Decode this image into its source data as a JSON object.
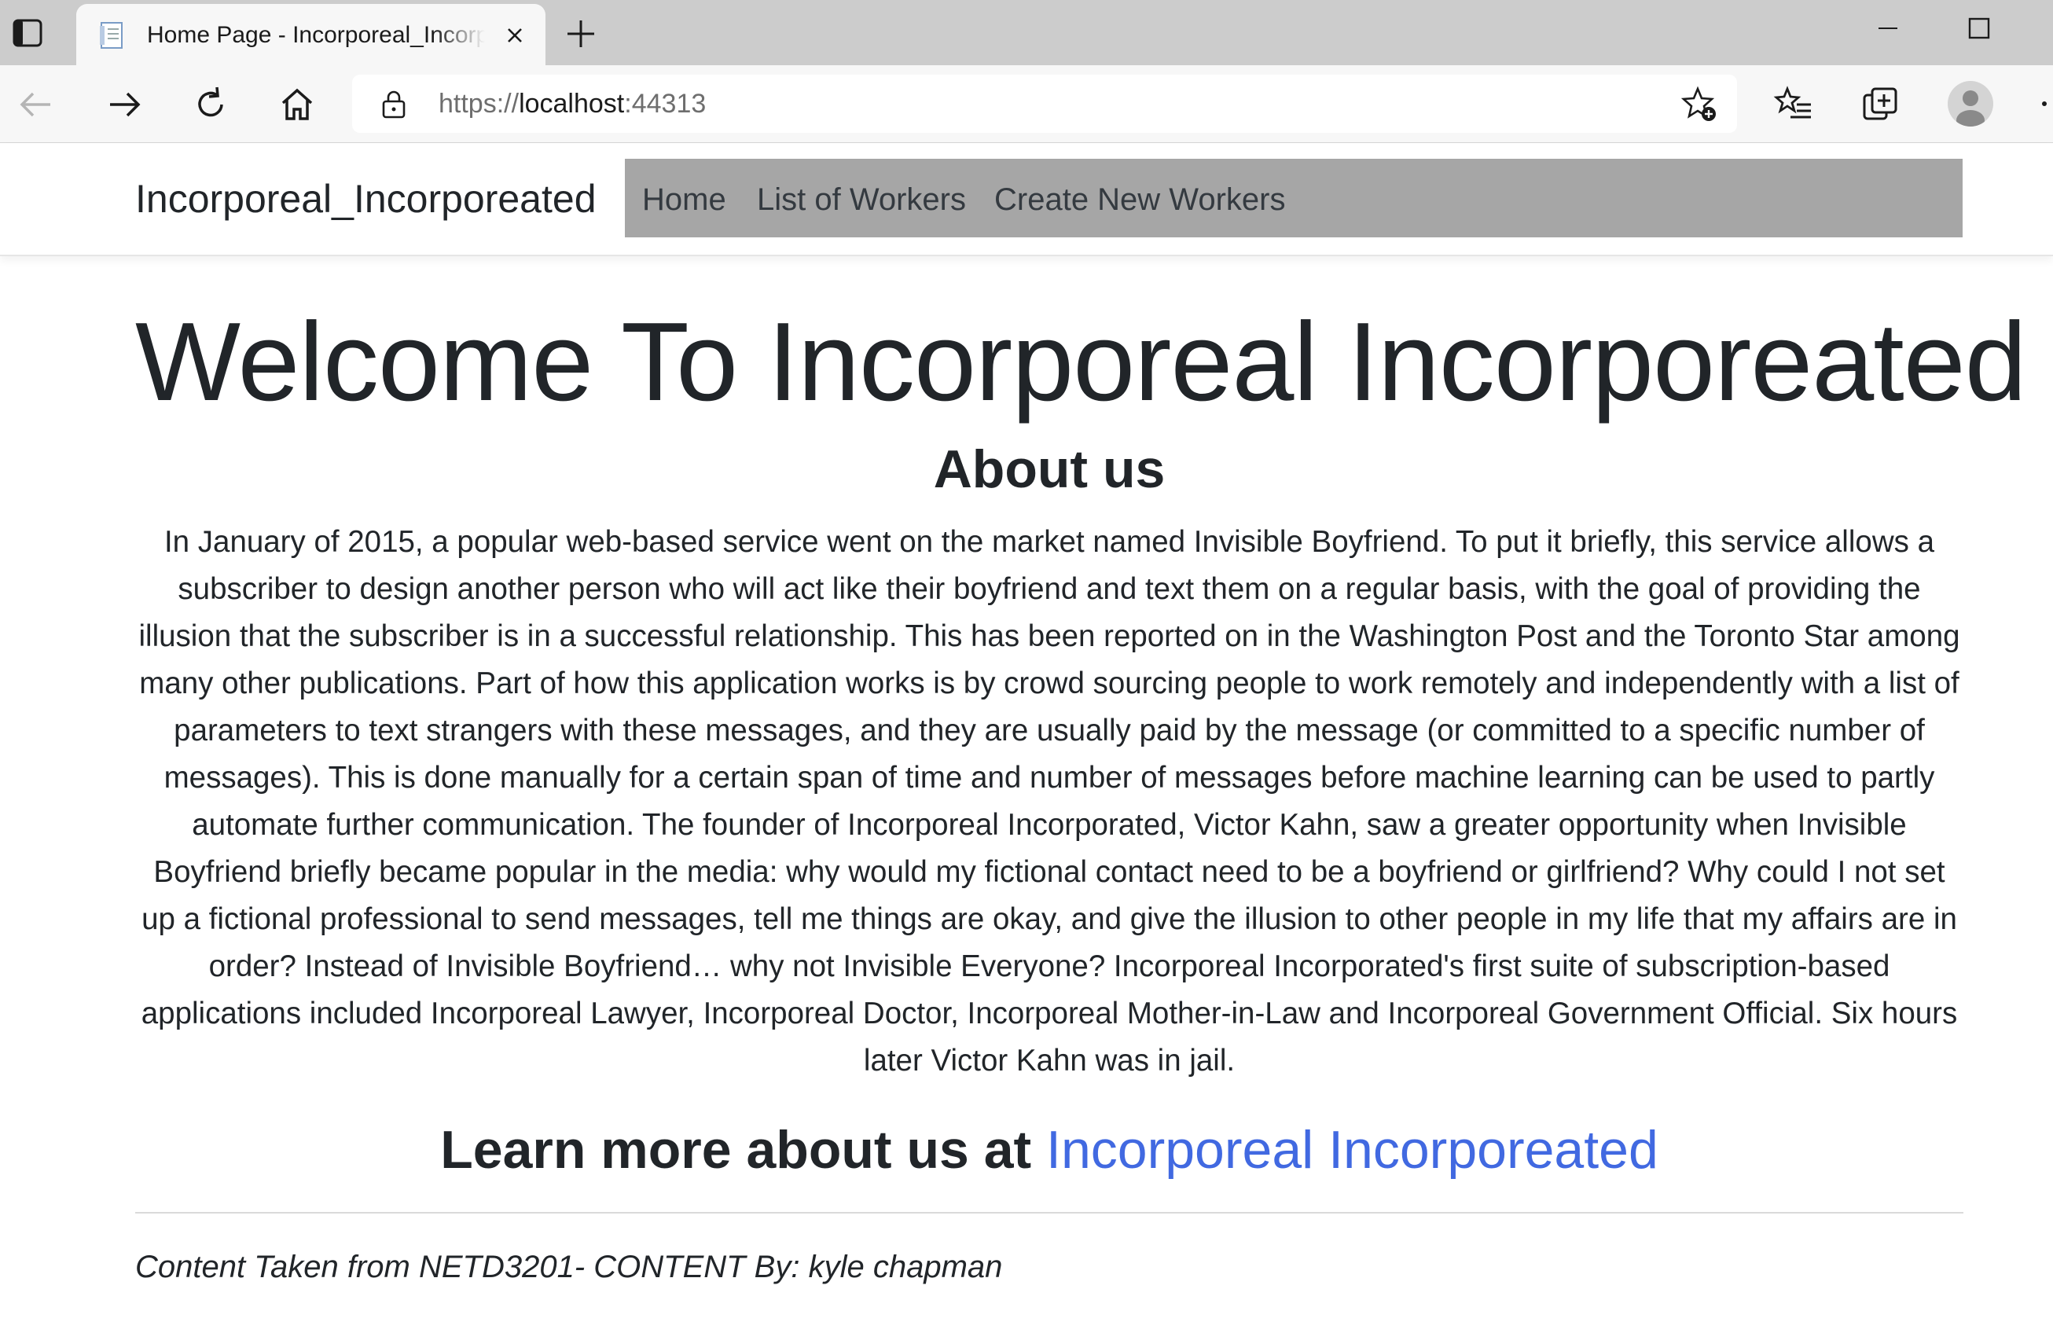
{
  "browser": {
    "tab_title": "Home Page - Incorporeal_Incorporeated",
    "url": {
      "scheme": "https://",
      "host": "localhost",
      "port": ":44313"
    }
  },
  "site": {
    "brand": "Incorporeal_Incorporeated",
    "nav": {
      "home": "Home",
      "list_workers": "List of Workers",
      "create_workers": "Create New Workers"
    },
    "nav_bg_color": "#a6a6a6"
  },
  "main": {
    "heading": "Welcome To Incorporeal Incorporeated",
    "about_title": "About us",
    "about_text": "In January of 2015, a popular web-based service went on the market named Invisible Boyfriend. To put it briefly, this service allows a subscriber to design another person who will act like their boyfriend and text them on a regular basis, with the goal of providing the illusion that the subscriber is in a successful relationship. This has been reported on in the Washington Post and the Toronto Star among many other publications. Part of how this application works is by crowd sourcing people to work remotely and independently with a list of parameters to text strangers with these messages, and they are usually paid by the message (or committed to a specific number of messages). This is done manually for a certain span of time and number of messages before machine learning can be used to partly automate further communication. The founder of Incorporeal Incorporated, Victor Kahn, saw a greater opportunity when Invisible Boyfriend briefly became popular in the media: why would my fictional contact need to be a boyfriend or girlfriend? Why could I not set up a fictional professional to send messages, tell me things are okay, and give the illusion to other people in my life that my affairs are in order? Instead of Invisible Boyfriend… why not Invisible Everyone? Incorporeal Incorporated's first suite of subscription-based applications included Incorporeal Lawyer, Incorporeal Doctor, Incorporeal Mother-in-Law and Incorporeal Government Official. Six hours later Victor Kahn was in jail.",
    "learn_more_prefix": "Learn more about us at ",
    "learn_more_link": "Incorporeal Incorporeated",
    "link_color": "#4169e1",
    "footer_note": "Content Taken from NETD3201- CONTENT By: kyle chapman"
  }
}
